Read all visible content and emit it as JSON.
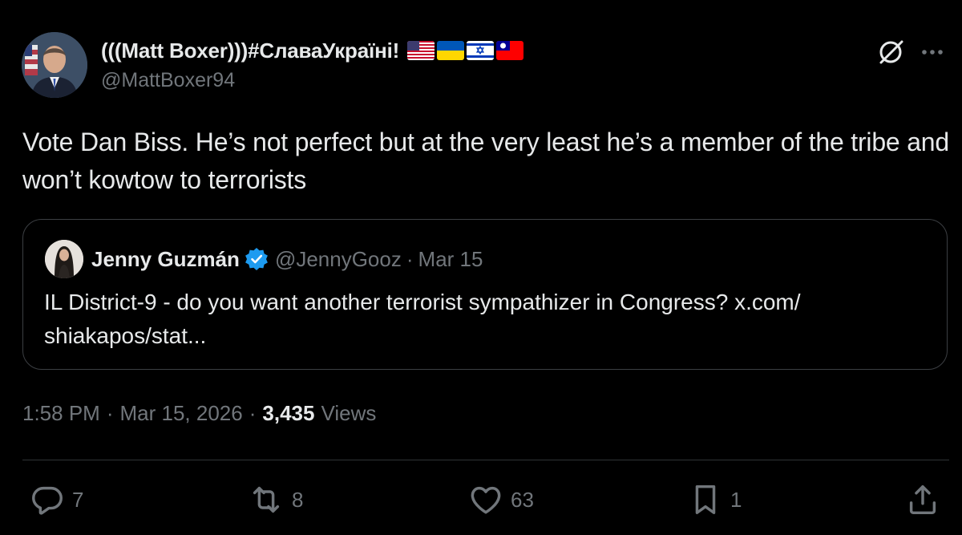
{
  "author": {
    "display_name": "(((Matt Boxer)))#СлаваУкраїні!",
    "handle": "@MattBoxer94",
    "flag_icons": [
      "us-flag-icon",
      "ukraine-flag-icon",
      "israel-flag-icon",
      "taiwan-flag-icon"
    ]
  },
  "tweet": {
    "text": "Vote Dan Biss. He’s not perfect but at the very least he’s a member of the tribe and won’t kowtow to terrorists"
  },
  "quote": {
    "name": "Jenny Guzmán",
    "handle": "@JennyGooz",
    "separator": "·",
    "date": "Mar 15",
    "text": "IL District-9 - do you want another terrorist sympathizer in Congress? x.com/ shiakapos/stat..."
  },
  "meta": {
    "time": "1:58 PM",
    "separator": "·",
    "date": "Mar 15, 2026",
    "views_count": "3,435",
    "views_label": "Views"
  },
  "actions": {
    "replies": "7",
    "reposts": "8",
    "likes": "63",
    "bookmarks": "1"
  },
  "colors": {
    "background": "#000000",
    "text": "#e7e9ea",
    "muted": "#71767b",
    "border": "#2f3336",
    "verified": "#1d9bf0"
  }
}
